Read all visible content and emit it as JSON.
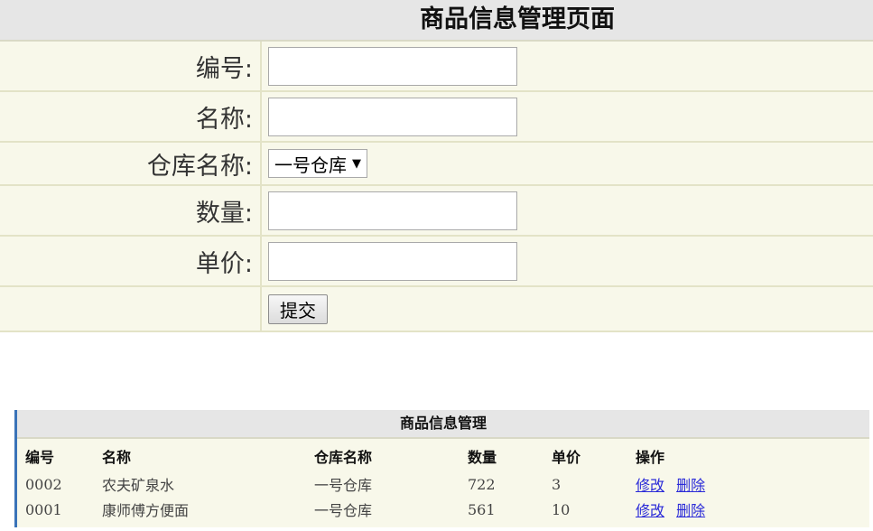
{
  "form": {
    "title": "商品信息管理页面",
    "fields": {
      "id_label": "编号:",
      "id_value": "",
      "name_label": "名称:",
      "name_value": "",
      "warehouse_label": "仓库名称:",
      "warehouse_selected": "一号仓库",
      "quantity_label": "数量:",
      "quantity_value": "",
      "price_label": "单价:",
      "price_value": ""
    },
    "submit_label": "提交"
  },
  "table": {
    "caption": "商品信息管理",
    "headers": [
      "编号",
      "名称",
      "仓库名称",
      "数量",
      "单价",
      "操作"
    ],
    "rows": [
      {
        "id": "0002",
        "name": "农夫矿泉水",
        "warehouse": "一号仓库",
        "quantity": "722",
        "price": "3",
        "edit": "修改",
        "delete": "删除"
      },
      {
        "id": "0001",
        "name": "康师傅方便面",
        "warehouse": "一号仓库",
        "quantity": "561",
        "price": "10",
        "edit": "修改",
        "delete": "删除"
      }
    ]
  },
  "colors": {
    "form_background": "#f8f8ea",
    "title_background": "#e6e6e6",
    "link": "#2a2ad8",
    "accent_border": "#3a73b8"
  },
  "icons": {
    "select_arrow": "caret-down-icon"
  }
}
